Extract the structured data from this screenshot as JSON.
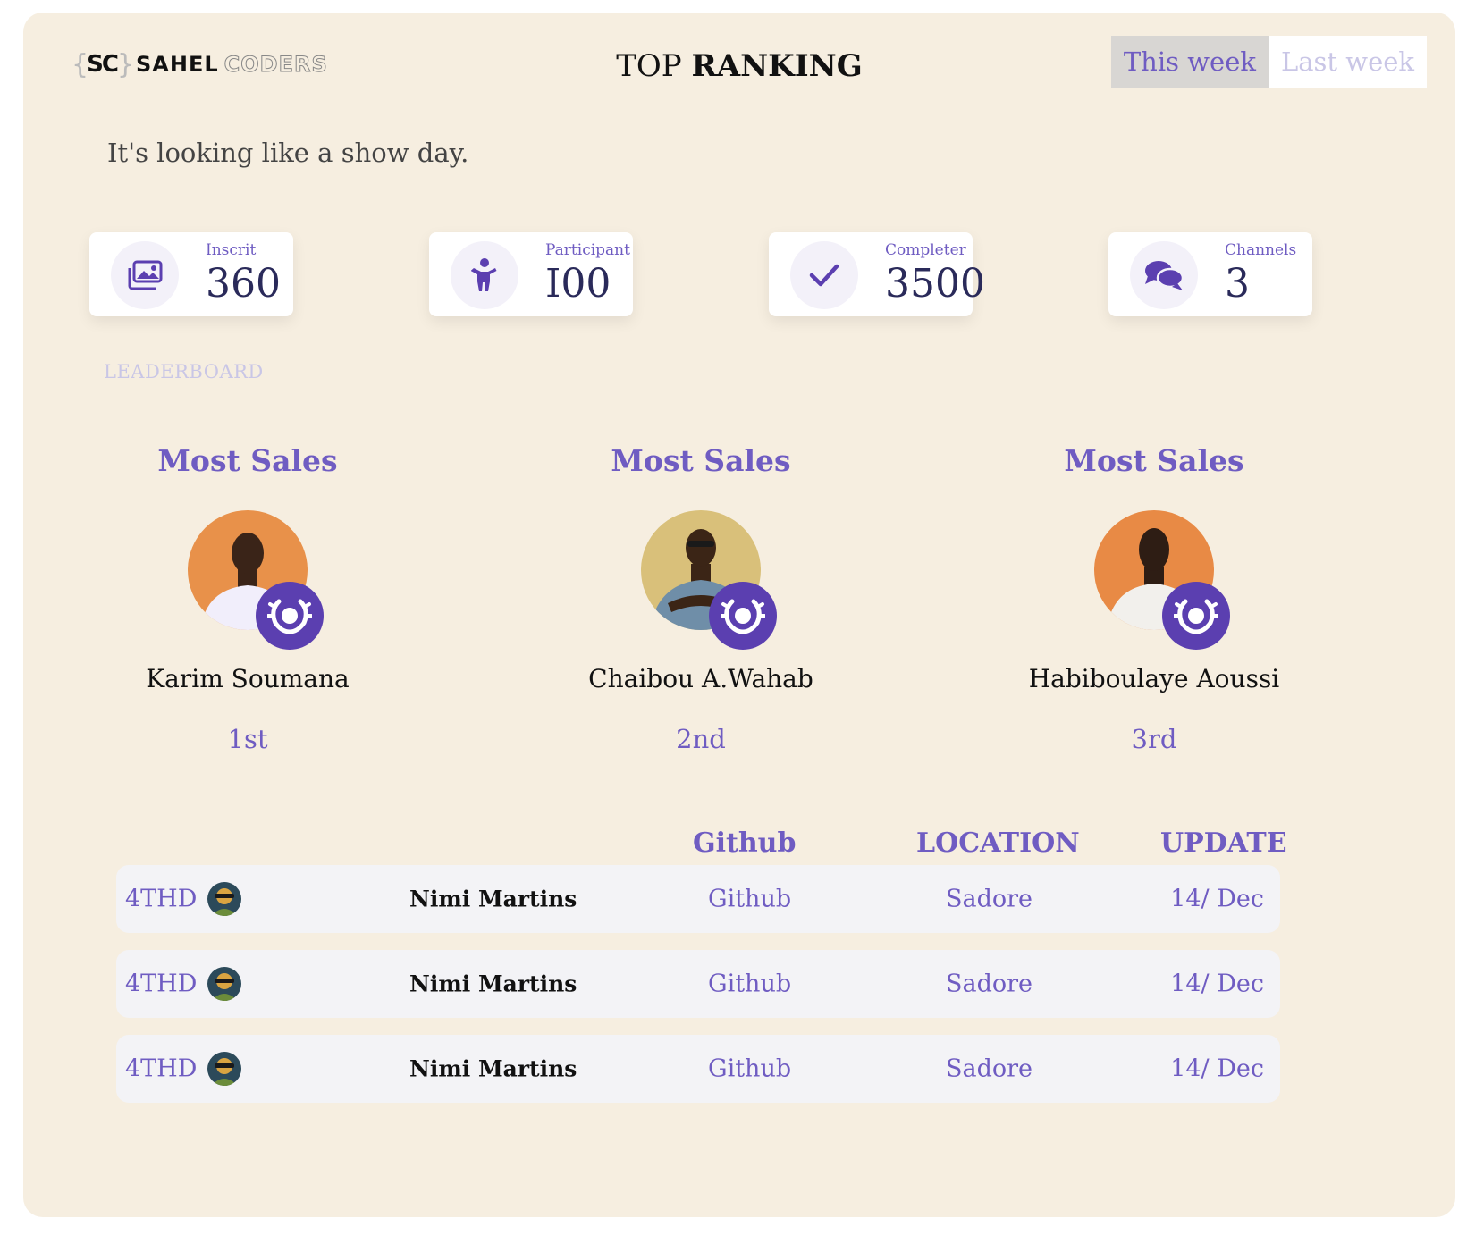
{
  "header": {
    "logo_mark": "SC",
    "logo_word_bold": "SAHEL",
    "logo_word_outline": "CODERS",
    "title_light": "TOP",
    "title_bold": "RANKING",
    "tabs": [
      {
        "label": "This week",
        "active": true
      },
      {
        "label": "Last week",
        "active": false
      }
    ]
  },
  "subtitle": "It's looking like a show day.",
  "stats": [
    {
      "label": "Inscrit",
      "value": "360",
      "icon": "images-icon"
    },
    {
      "label": "Participant",
      "value": "I00",
      "icon": "person-icon"
    },
    {
      "label": "Completer",
      "value": "3500",
      "icon": "check-icon"
    },
    {
      "label": "Channels",
      "value": "3",
      "icon": "chat-bubbles-icon"
    }
  ],
  "leaderboard_label": "LEADERBOARD",
  "podium": [
    {
      "title": "Most Sales",
      "name": "Karim Soumana",
      "rank": "1st",
      "avatar_bg": "#e8914a",
      "shirt": "#f1eefb"
    },
    {
      "title": "Most Sales",
      "name": "Chaibou A.Wahab",
      "rank": "2nd",
      "avatar_bg": "#d9c07a",
      "shirt": "#6f8ea8"
    },
    {
      "title": "Most Sales",
      "name": "Habiboulaye Aoussi",
      "rank": "3rd",
      "avatar_bg": "#e88a45",
      "shirt": "#f2f0ec"
    }
  ],
  "table": {
    "headers": {
      "github": "Github",
      "location": "LOCATION",
      "update": "UPDATE"
    },
    "rows": [
      {
        "rank": "4THD",
        "name": "Nimi Martins",
        "github": "Github",
        "location": "Sadore",
        "update": "14/ Dec"
      },
      {
        "rank": "4THD",
        "name": "Nimi Martins",
        "github": "Github",
        "location": "Sadore",
        "update": "14/ Dec"
      },
      {
        "rank": "4THD",
        "name": "Nimi Martins",
        "github": "Github",
        "location": "Sadore",
        "update": "14/ Dec"
      }
    ]
  },
  "colors": {
    "accent": "#6f5cc2",
    "badge": "#5b3fb0",
    "card_bg": "#f6eee0"
  }
}
